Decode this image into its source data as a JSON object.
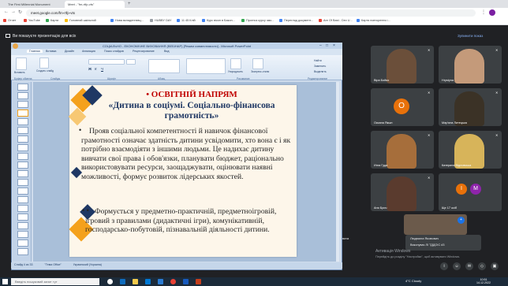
{
  "browser": {
    "tabs": [
      {
        "label": "The First Millennial Monument"
      },
      {
        "label": "Meet - \"fm-rtfp-vts\""
      }
    ],
    "url": "meet.google.com/fm-rtfp-vts",
    "bookmarks": [
      "Отчет",
      "YouTube",
      "Карти",
      "Головний шкільний",
      "Нова вкладеннєвц...",
      "HUBBY DAY",
      "11 45 Клій",
      "Курс вікон в Бакоп...",
      "Прогноз курсу змо...",
      "Перегляд документ...",
      "Are Of Bast - Dev U...",
      "Картя повторення і..."
    ]
  },
  "meet": {
    "presenting_text": "Ви показуєте презентацію для всіх",
    "stop_presenting": "Зупинити показ",
    "participants": [
      {
        "name": "Віра Бойко",
        "avatar_letter": "",
        "color": "#6b4f3a",
        "mic_muted": true
      },
      {
        "name": "Hrystyna",
        "avatar_letter": "",
        "color": "#c49a7a",
        "mic_muted": true
      },
      {
        "name": "Оксана Якшн",
        "avatar_letter": "O",
        "color": "#e8710a",
        "mic_muted": true
      },
      {
        "name": "Мар'яна Литецька",
        "avatar_letter": "",
        "color": "#3b3226",
        "mic_muted": true
      },
      {
        "name": "Инга Гуда",
        "avatar_letter": "",
        "color": "#a66e3b",
        "mic_muted": true
      },
      {
        "name": "Катерина Відловська",
        "avatar_letter": "",
        "color": "#d7b45a",
        "mic_muted": true
      },
      {
        "name": "Аня Брич",
        "avatar_letter": "",
        "color": "#5a3b2e",
        "mic_muted": true
      },
      {
        "name": "Ще 17 осіб",
        "avatar_letter": "",
        "color": "#3c4043",
        "mic_muted": false
      }
    ],
    "self_name": "Людмила Яковович",
    "self_subtitle": "Виконувач ЛІ ТДДОІС #3",
    "activate_windows": "Активація Windows",
    "activate_windows_sub": "Перейдіть до розділу \"Настройки\", щоб активувати Windows."
  },
  "ppt": {
    "window_title": "СОЦІАЛЬНО - ЕКОНОМІЧНЕ ВИХОВАННЯ (ВЕБІНАР) [Режим совместимости] - Microsoft PowerPoint",
    "ribbon_tabs": [
      "Главная",
      "Вставка",
      "Дизайн",
      "Анимация",
      "Показ слайдов",
      "Рецензирование",
      "Вид"
    ],
    "ribbon_groups": [
      "Буфер обмена",
      "Слайды",
      "Шрифт",
      "Абзац",
      "Рисование",
      "Редактирование"
    ],
    "ribbon_buttons": [
      "Вставить",
      "Создать слайд",
      "Упорядочить",
      "Экспресс-стили",
      "Найти",
      "Заменить",
      "Выделить"
    ],
    "status": "Слайд 4 из 33",
    "status_theme": "\"Тема Office\"",
    "status_lang": "Украинский (Украина)"
  },
  "slide": {
    "heading": "• ОСВІТНІЙ НАПРЯМ",
    "title": "«Дитина в соціумі. Соціально-фінансова грамотність»",
    "paragraph1": "Прояв соціальної компетентності й навичок фінансової грамотності означає здатність дитини усвідомити, хто вона є і як потрібно взаємодіяти з іншими людьми. Це надихає дитину вивчати свої права і обов'язки, планувати бюджет, раціонально використовувати ресурси, заощаджувати, оцінювати наявні можливості, формує розвиток лідерських якостей.",
    "paragraph2": "Формується у предметно-практичній, предметноігровій, ігровий з правилами (дидактичні ігри), комунікативній, господарсько-побутовій, пізнавальній діяльності дитини."
  },
  "taskbar": {
    "search_placeholder": "Введіть пошуковий запит тут",
    "weather": "4°C  Cloudy",
    "time": "10:51",
    "date": "14.12.2022"
  }
}
